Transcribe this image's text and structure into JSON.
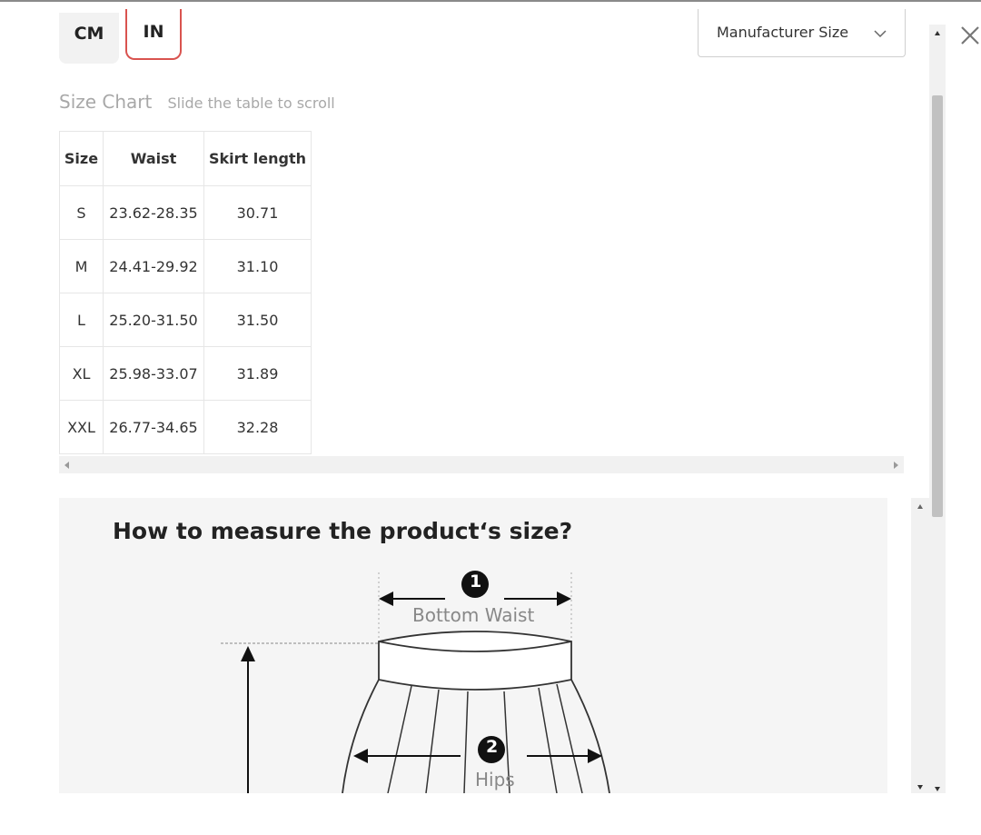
{
  "units": {
    "cm_label": "CM",
    "in_label": "IN",
    "selected": "IN"
  },
  "size_select": {
    "value": "Manufacturer Size"
  },
  "size_chart": {
    "title": "Size Chart",
    "hint": "Slide the table to scroll",
    "headers": [
      "Size",
      "Waist",
      "Skirt length"
    ],
    "rows": [
      [
        "S",
        "23.62-28.35",
        "30.71"
      ],
      [
        "M",
        "24.41-29.92",
        "31.10"
      ],
      [
        "L",
        "25.20-31.50",
        "31.50"
      ],
      [
        "XL",
        "25.98-33.07",
        "31.89"
      ],
      [
        "XXL",
        "26.77-34.65",
        "32.28"
      ]
    ]
  },
  "measure": {
    "title": "How to measure the product‘s size?",
    "step1_number": "1",
    "step1_label": "Bottom Waist",
    "step2_number": "2",
    "step2_label": "Hips"
  },
  "colors": {
    "accent": "#d9534f",
    "muted_text": "#a8a8a8",
    "panel_bg": "#f5f5f5"
  },
  "icons": {
    "close": "close-icon",
    "chevron": "chevron-down-icon"
  }
}
